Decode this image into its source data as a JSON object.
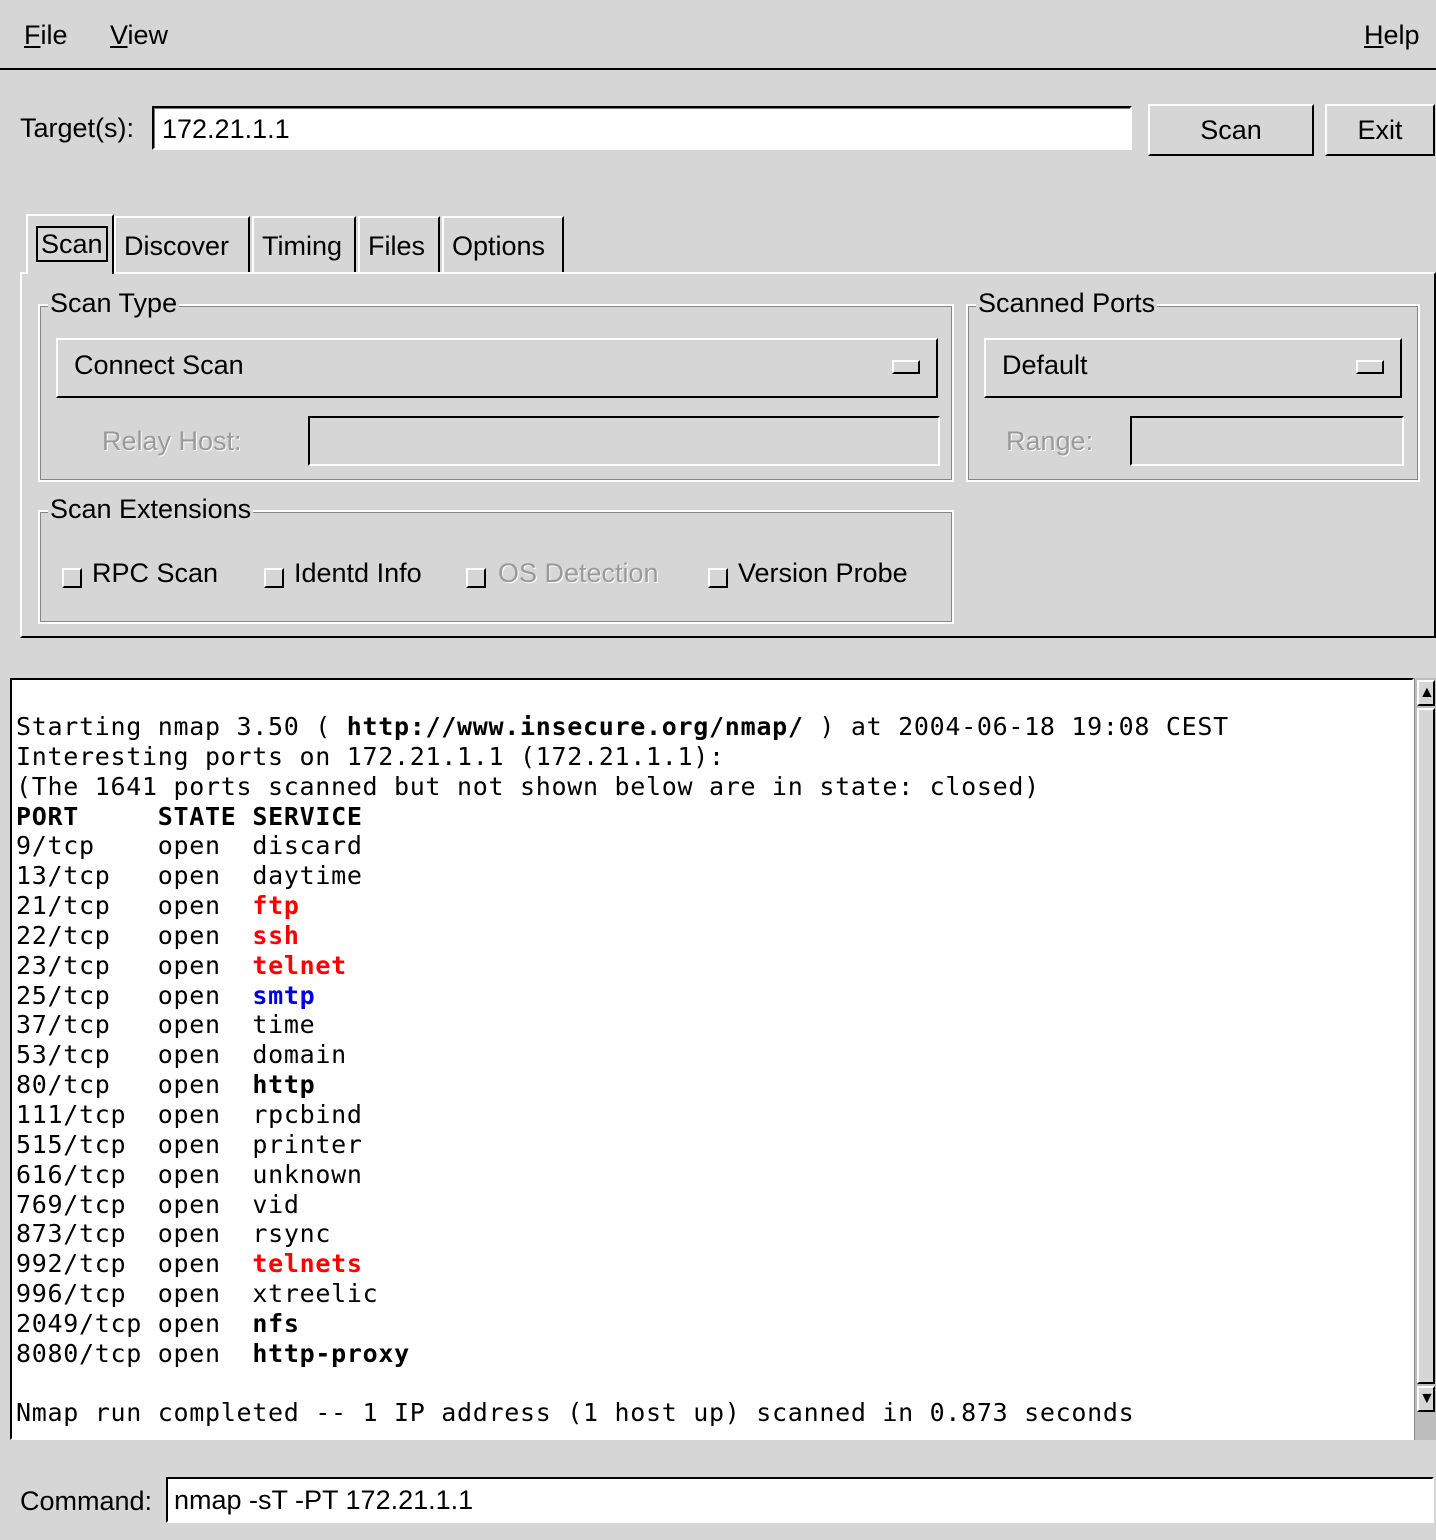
{
  "menubar": {
    "file": "File",
    "view": "View",
    "help": "Help"
  },
  "target": {
    "label": "Target(s):",
    "value": "172.21.1.1"
  },
  "buttons": {
    "scan": "Scan",
    "exit": "Exit"
  },
  "tabs": [
    "Scan",
    "Discover",
    "Timing",
    "Files",
    "Options"
  ],
  "scan_type": {
    "title": "Scan Type",
    "selected": "Connect Scan",
    "relay_label": "Relay Host:",
    "relay_value": ""
  },
  "scanned_ports": {
    "title": "Scanned Ports",
    "selected": "Default",
    "range_label": "Range:",
    "range_value": ""
  },
  "scan_extensions": {
    "title": "Scan Extensions",
    "options": [
      {
        "label": "RPC Scan",
        "checked": false,
        "enabled": true
      },
      {
        "label": "Identd Info",
        "checked": false,
        "enabled": true
      },
      {
        "label": "OS Detection",
        "checked": false,
        "enabled": false
      },
      {
        "label": "Version Probe",
        "checked": false,
        "enabled": true
      }
    ]
  },
  "output": {
    "start_prefix": "Starting nmap 3.50 ( ",
    "start_url": "http://www.insecure.org/nmap/",
    "start_suffix": " ) at 2004-06-18 19:08 CEST",
    "interesting": "Interesting ports on 172.21.1.1 (172.21.1.1):",
    "not_shown": "(The 1641 ports scanned but not shown below are in state: closed)",
    "header": {
      "port": "PORT",
      "state": "STATE",
      "service": "SERVICE"
    },
    "ports": [
      {
        "port": "9/tcp",
        "state": "open",
        "service": "discard",
        "style": "normal"
      },
      {
        "port": "13/tcp",
        "state": "open",
        "service": "daytime",
        "style": "normal"
      },
      {
        "port": "21/tcp",
        "state": "open",
        "service": "ftp",
        "style": "red"
      },
      {
        "port": "22/tcp",
        "state": "open",
        "service": "ssh",
        "style": "red"
      },
      {
        "port": "23/tcp",
        "state": "open",
        "service": "telnet",
        "style": "red"
      },
      {
        "port": "25/tcp",
        "state": "open",
        "service": "smtp",
        "style": "blue"
      },
      {
        "port": "37/tcp",
        "state": "open",
        "service": "time",
        "style": "normal"
      },
      {
        "port": "53/tcp",
        "state": "open",
        "service": "domain",
        "style": "normal"
      },
      {
        "port": "80/tcp",
        "state": "open",
        "service": "http",
        "style": "bold"
      },
      {
        "port": "111/tcp",
        "state": "open",
        "service": "rpcbind",
        "style": "normal"
      },
      {
        "port": "515/tcp",
        "state": "open",
        "service": "printer",
        "style": "normal"
      },
      {
        "port": "616/tcp",
        "state": "open",
        "service": "unknown",
        "style": "normal"
      },
      {
        "port": "769/tcp",
        "state": "open",
        "service": "vid",
        "style": "normal"
      },
      {
        "port": "873/tcp",
        "state": "open",
        "service": "rsync",
        "style": "normal"
      },
      {
        "port": "992/tcp",
        "state": "open",
        "service": "telnets",
        "style": "red"
      },
      {
        "port": "996/tcp",
        "state": "open",
        "service": "xtreelic",
        "style": "normal"
      },
      {
        "port": "2049/tcp",
        "state": "open",
        "service": "nfs",
        "style": "bold"
      },
      {
        "port": "8080/tcp",
        "state": "open",
        "service": "http-proxy",
        "style": "bold"
      }
    ],
    "completed": "Nmap run completed -- 1 IP address (1 host up) scanned in 0.873 seconds"
  },
  "command": {
    "label": "Command:",
    "value": "nmap -sT -PT 172.21.1.1"
  },
  "colors": {
    "background": "#d6d6d6",
    "danger": "#ff0000",
    "mail": "#0000e0"
  }
}
